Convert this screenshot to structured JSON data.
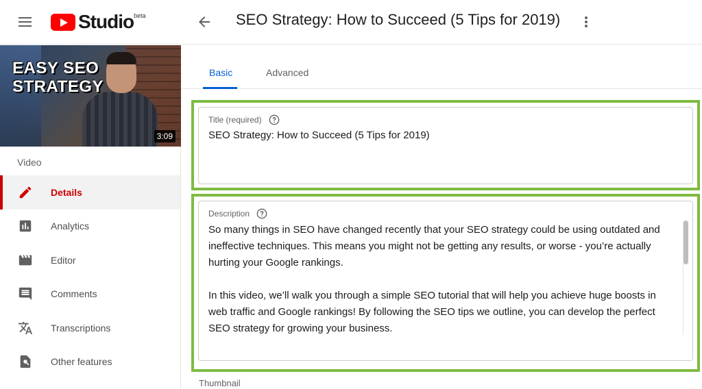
{
  "header": {
    "logo_text": "Studio",
    "logo_badge": "beta",
    "page_title": "SEO Strategy: How to Succeed (5 Tips for 2019)"
  },
  "sidebar": {
    "thumbnail": {
      "text_line1": "EASY SEO",
      "text_line2": "STRATEGY",
      "duration": "3:09"
    },
    "section_label": "Video",
    "items": [
      {
        "label": "Details",
        "icon": "pencil-icon",
        "active": true
      },
      {
        "label": "Analytics",
        "icon": "analytics-icon",
        "active": false
      },
      {
        "label": "Editor",
        "icon": "editor-icon",
        "active": false
      },
      {
        "label": "Comments",
        "icon": "comments-icon",
        "active": false
      },
      {
        "label": "Transcriptions",
        "icon": "translate-icon",
        "active": false
      },
      {
        "label": "Other features",
        "icon": "other-features-icon",
        "active": false
      }
    ]
  },
  "tabs": [
    {
      "label": "Basic",
      "active": true
    },
    {
      "label": "Advanced",
      "active": false
    }
  ],
  "title_field": {
    "label": "Title (required)",
    "value": "SEO Strategy: How to Succeed (5 Tips for 2019)"
  },
  "description_field": {
    "label": "Description",
    "paragraph1": "So many things in SEO have changed recently that your SEO strategy could be using outdated and ineffective techniques. This means you might not be getting any results, or worse - you’re actually hurting your Google rankings.",
    "paragraph2": "In this video, we’ll walk you through a simple SEO tutorial that will help you achieve huge boosts in web traffic and Google rankings! By following the SEO tips we outline, you can develop the perfect SEO strategy for growing your business."
  },
  "thumbnail_section_label": "Thumbnail",
  "colors": {
    "accent_blue": "#065fd4",
    "active_red": "#cc0000",
    "highlight_green": "#7dbb42",
    "youtube_red": "#ff0000"
  }
}
